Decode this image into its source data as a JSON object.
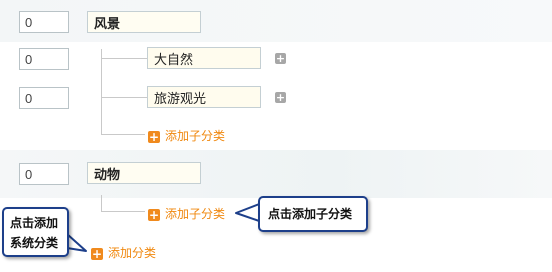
{
  "categories": [
    {
      "sort": "0",
      "name": "风景",
      "children": [
        {
          "sort": "0",
          "name": "大自然"
        },
        {
          "sort": "0",
          "name": "旅游观光"
        }
      ],
      "add_sub_label": "添加子分类"
    },
    {
      "sort": "0",
      "name": "动物",
      "children": [],
      "add_sub_label": "添加子分类"
    }
  ],
  "add_category_label": "添加分类",
  "callouts": {
    "add_sub": "点击添加子分类",
    "add_system": "点击添加系统分类"
  },
  "icons": {
    "child_add": "plus-gray-icon",
    "link_add": "plus-orange-icon"
  },
  "colors": {
    "accent": "#f0880f",
    "callout_border": "#1d3f8a",
    "name_input_bg": "#fffcee"
  }
}
